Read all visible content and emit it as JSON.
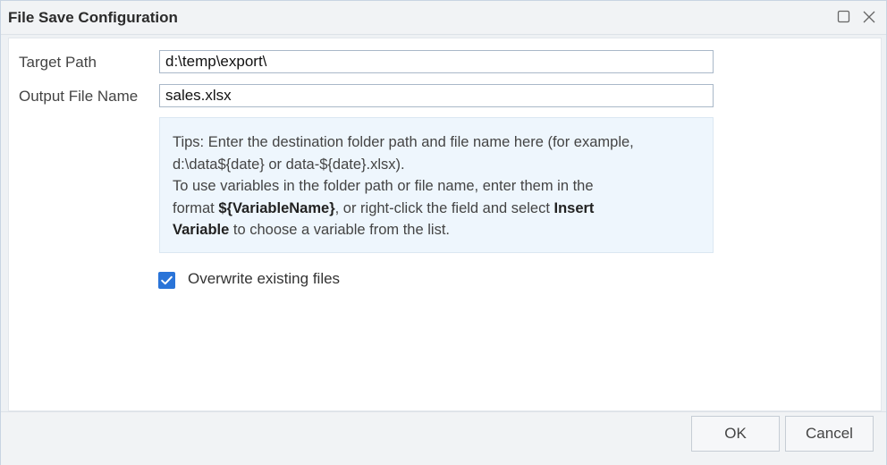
{
  "dialog": {
    "title": "File Save Configuration",
    "window_buttons": {
      "maximize_icon": "maximize-icon",
      "close_icon": "close-icon"
    }
  },
  "form": {
    "target_path": {
      "label": "Target Path",
      "value": "d:\\temp\\export\\"
    },
    "output_file_name": {
      "label": "Output File Name",
      "value": "sales.xlsx"
    },
    "tips": {
      "line1": "Tips: Enter the destination folder path and file name here (for example,",
      "line2": "d:\\data${date} or data-${date}.xlsx).",
      "line3": "To use variables in the folder path or file name, enter them in the",
      "line4_prefix": "format ",
      "line4_bold": "${VariableName}",
      "line4_middle": ", or right-click the field and select ",
      "line4_bold2": "Insert",
      "line5_bold": "Variable",
      "line5_suffix": " to choose a variable from the list."
    },
    "overwrite": {
      "label": "Overwrite existing files",
      "checked": true
    }
  },
  "footer": {
    "ok_label": "OK",
    "cancel_label": "Cancel"
  },
  "colors": {
    "accent": "#2a74d8",
    "tips_background": "#eef6fd",
    "dialog_chrome": "#f1f3f5"
  }
}
